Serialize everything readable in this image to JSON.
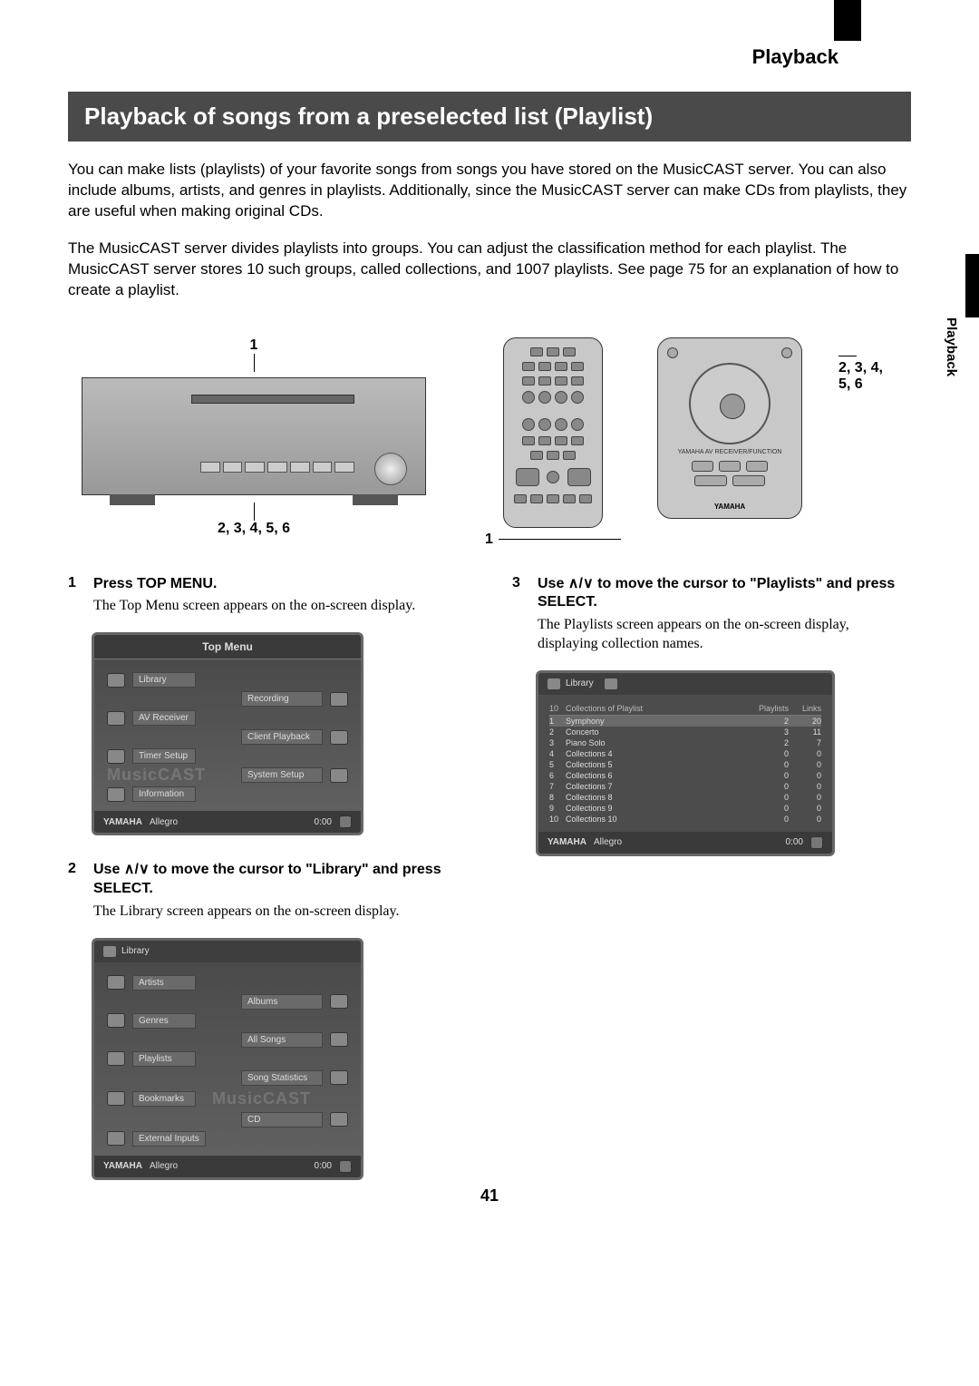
{
  "breadcrumb": "Playback",
  "vertical_tab": "Playback",
  "title": "Playback of songs from a preselected list (Playlist)",
  "intro1": "You can make lists (playlists) of your favorite songs from songs you have stored on the MusicCAST server. You can also include albums, artists, and genres in playlists. Additionally, since the MusicCAST server can make CDs from playlists, they are useful when making original CDs.",
  "intro2": "The MusicCAST server divides playlists into groups. You can adjust the classification method for each playlist. The MusicCAST server stores 10 such groups, called collections, and 1007 playlists. See page 75 for an explanation of how to create a playlist.",
  "diagram": {
    "device_top": "1",
    "device_bottom": "2, 3, 4, 5, 6",
    "remote_left": "1",
    "remote_right_line1": "2, 3, 4,",
    "remote_right_line2": "5, 6",
    "remote2_label": "YAMAHA AV RECEIVER/FUNCTION",
    "remote2_logo": "YAMAHA"
  },
  "steps": {
    "s1": {
      "num": "1",
      "title": "Press TOP MENU.",
      "body": "The Top Menu screen appears on the on-screen display."
    },
    "s2": {
      "num": "2",
      "title_a": "Use ",
      "title_b": " to move the cursor to \"Library\" and press SELECT.",
      "body": "The Library screen appears on the on-screen display."
    },
    "s3": {
      "num": "3",
      "title_a": "Use ",
      "title_b": " to move the cursor to \"Playlists\" and press SELECT.",
      "body": "The Playlists screen appears on the on-screen display, displaying collection names."
    }
  },
  "screen1": {
    "title": "Top Menu",
    "items_left": [
      "Library",
      "AV Receiver",
      "Timer Setup",
      "Information"
    ],
    "items_right": [
      "Recording",
      "Client Playback",
      "System Setup"
    ],
    "watermark": "MusicCAST",
    "footer_brand": "YAMAHA",
    "footer_track": "Allegro",
    "footer_time": "0:00"
  },
  "screen2": {
    "crumb": "Library",
    "items_left": [
      "Artists",
      "Genres",
      "Playlists",
      "Bookmarks",
      "External Inputs"
    ],
    "items_right": [
      "Albums",
      "All Songs",
      "Song Statistics",
      "CD"
    ],
    "watermark": "MusicCAST",
    "footer_brand": "YAMAHA",
    "footer_track": "Allegro",
    "footer_time": "0:00"
  },
  "screen3": {
    "crumb": "Library",
    "table_header": {
      "count": "10",
      "label": "Collections of Playlist",
      "col_p": "Playlists",
      "col_l": "Links"
    },
    "rows": [
      {
        "n": "1",
        "name": "Symphony",
        "p": "2",
        "l": "20"
      },
      {
        "n": "2",
        "name": "Concerto",
        "p": "3",
        "l": "11"
      },
      {
        "n": "3",
        "name": "Piano Solo",
        "p": "2",
        "l": "7"
      },
      {
        "n": "4",
        "name": "Collections  4",
        "p": "0",
        "l": "0"
      },
      {
        "n": "5",
        "name": "Collections  5",
        "p": "0",
        "l": "0"
      },
      {
        "n": "6",
        "name": "Collections  6",
        "p": "0",
        "l": "0"
      },
      {
        "n": "7",
        "name": "Collections  7",
        "p": "0",
        "l": "0"
      },
      {
        "n": "8",
        "name": "Collections  8",
        "p": "0",
        "l": "0"
      },
      {
        "n": "9",
        "name": "Collections  9",
        "p": "0",
        "l": "0"
      },
      {
        "n": "10",
        "name": "Collections 10",
        "p": "0",
        "l": "0"
      }
    ],
    "footer_brand": "YAMAHA",
    "footer_track": "Allegro",
    "footer_time": "0:00"
  },
  "page_number": "41"
}
